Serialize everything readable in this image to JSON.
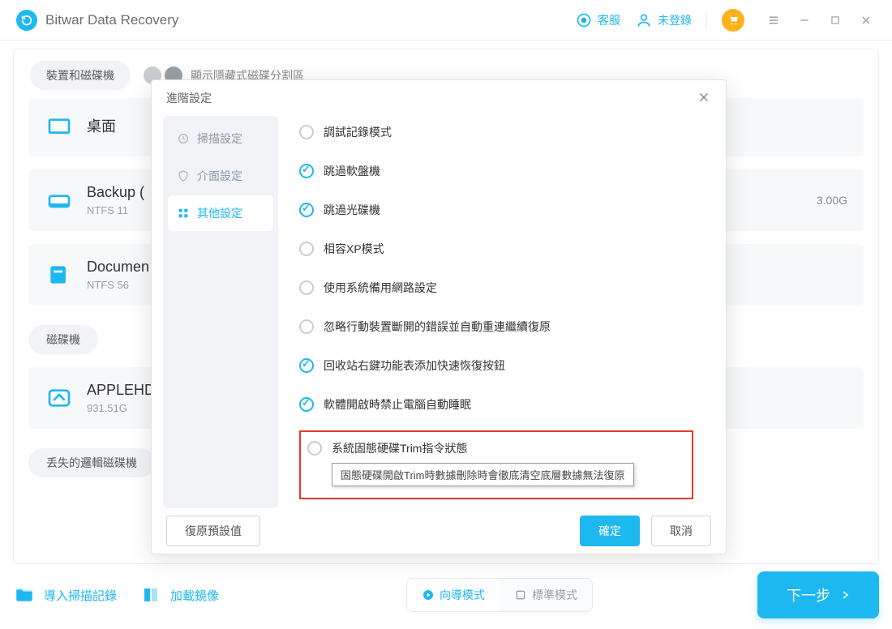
{
  "app": {
    "title": "Bitwar Data Recovery"
  },
  "titlebar": {
    "support": "客服",
    "login": "未登錄"
  },
  "tabs": {
    "devices": "裝置和磁碟機",
    "hidden_partition": "顯示隱藏式磁碟分割區"
  },
  "items": {
    "desktop": {
      "title": "桌面"
    },
    "backup": {
      "title": "Backup (",
      "sub": "NTFS    11"
    },
    "documents": {
      "title": "Documen",
      "sub": "NTFS    56"
    },
    "size_right": "3.00G"
  },
  "sections": {
    "drives": "磁碟機",
    "lost": "丢失的邏輯磁碟機"
  },
  "drive": {
    "title": "APPLEHD",
    "sub": "931.51G"
  },
  "bottom": {
    "import": "導入掃描記錄",
    "load": "加載鏡像",
    "wizard": "向導模式",
    "standard": "標準模式",
    "next": "下一步"
  },
  "dialog": {
    "title": "進階設定",
    "side": {
      "scan": "掃描設定",
      "ui": "介面設定",
      "other": "其他設定"
    },
    "opts": {
      "debug": "調試記錄模式",
      "floppy": "跳過軟盤機",
      "optical": "跳過光碟機",
      "xp": "相容XP模式",
      "backupnet": "使用系統備用網路設定",
      "ignore": "忽略行動裝置斷開的錯誤並自動重連繼續復原",
      "recycle": "回收站右鍵功能表添加快速恢復按鈕",
      "sleep": "軟體開啟時禁止電腦自動睡眠",
      "trim": "系統固態硬碟Trim指令狀態"
    },
    "tooltip": "固態硬碟開啟Trim時數據刪除時會徹底清空底層數據無法復原",
    "buttons": {
      "restore": "復原預設值",
      "ok": "確定",
      "cancel": "取消"
    }
  }
}
